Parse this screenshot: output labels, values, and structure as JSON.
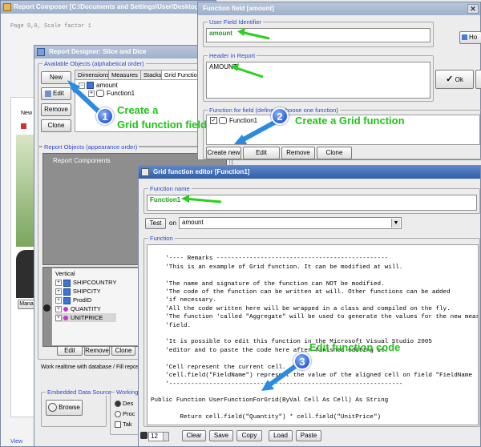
{
  "report_composer": {
    "title": "Report Composer [C:\\Documents and Settings\\User\\Desktop\\",
    "page_info": "Page 0,0, Scale factor 1",
    "new_label": "New",
    "mana_label": "Mana",
    "view_label": "View"
  },
  "designer": {
    "title": "Report Designer: Slice and Dice",
    "available_label": "Available Objects (alphabetical order)",
    "tabs": [
      "Dimensions",
      "Measures",
      "Stacks",
      "Grid Functions"
    ],
    "buttons": {
      "new": "New",
      "edit": "Edit",
      "remove": "Remove",
      "clone": "Clone"
    },
    "tree_root": "amount",
    "tree_child": "Function1",
    "report_objects_label": "Report Objects (appearance order)",
    "report_components": "Report Components",
    "vertical_label": "Vertical",
    "vertical_items": [
      "SHIPCOUNTRY",
      "SHIPCITY",
      "ProdID",
      "QUANTITY",
      "UNITPRICE"
    ],
    "bottom_buttons": {
      "edit": "Edit",
      "remove": "Remove",
      "clone": "Clone"
    },
    "realtime_label": "Work realtime with database / Fill reposito",
    "embedded_label": "Embedded Data Source",
    "browse_label": "Browse",
    "working_label": "Working",
    "options": [
      "Des",
      "Proc",
      "Tak"
    ]
  },
  "function_field": {
    "title": "Function field [amount]",
    "identifier_label": "User Field Identifier",
    "identifier_value": "amount",
    "header_label": "Header in Report",
    "header_value": "AMOUNT",
    "function_for_field_label": "Function for field (define or choose one function)",
    "function_item": "Function1",
    "buttons": {
      "create_new": "Create new",
      "edit": "Edit",
      "remove": "Remove",
      "clone": "Clone"
    },
    "ok_label": "Ok",
    "ho_label": "Ho"
  },
  "grid_editor": {
    "title": "Grid function editor [Function1]",
    "function_name_label": "Function name",
    "function_name_value": "Function1",
    "test_label": "Test",
    "on_label": "on",
    "on_value": "amount",
    "function_label": "Function",
    "code_lines": [
      "",
      "    '---- Remarks -----------------------------------------------",
      "    'This is an example of Grid function. It can be modified at will.",
      "",
      "    'The name and signature of the function can NOT be modified.",
      "    'The code of the function can be written at will. Other functions can be added",
      "    'if necessary.",
      "    'All the code written here will be wrapped in a class and compiled on the fly.",
      "    'The function 'called \"Aggregate\" will be used to generate the values for the new meas",
      "    'field.",
      "",
      "    'It is possible to edit this function in the Microsoft Visual Studio 2005",
      "    'editor and to paste the code here after finished editing it.",
      "",
      "    'Cell represent the current cell.",
      "    'cell.field(\"FieldName\") represent the value of the aligned cell on field \"FieldName",
      "    '----------------------------------------------------------------",
      "",
      "Public Function UserFunctionForGrid(ByVal Cell As Cell) As String",
      "",
      "        Return cell.field(\"Quantity\") * cell.field(\"UnitPrice\")",
      "",
      "End Function"
    ],
    "font_size": "12",
    "buttons": {
      "clear": "Clear",
      "save": "Save",
      "copy": "Copy",
      "load": "Load",
      "paste": "Paste"
    }
  },
  "callouts": [
    {
      "number": "1",
      "text_line1": "Create a",
      "text_line2": "Grid function field"
    },
    {
      "number": "2",
      "text": "Create a Grid function"
    },
    {
      "number": "3",
      "text": "Edit function code"
    }
  ],
  "colors": {
    "callout_green": "#22c31a",
    "badge_blue": "#2d5fd8",
    "title_active": "#2f5ea9",
    "group_label": "#2a49c9"
  }
}
